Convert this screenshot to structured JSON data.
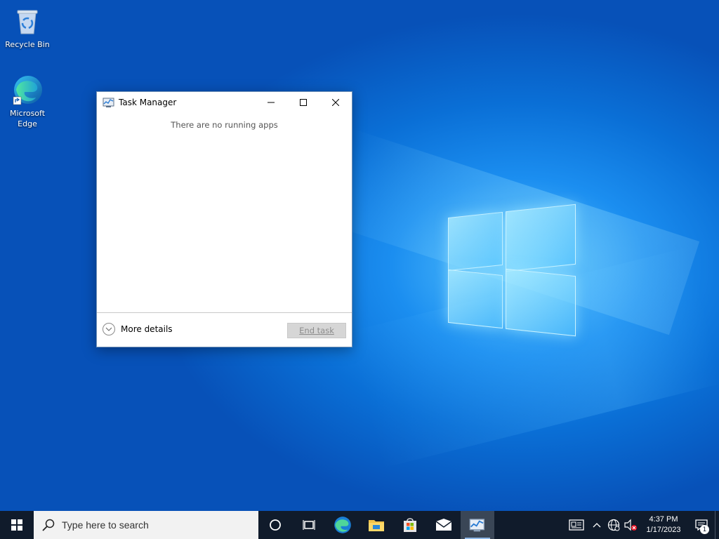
{
  "desktop": {
    "icons": [
      {
        "label": "Recycle Bin",
        "icon": "recycle-bin-icon"
      },
      {
        "label": "Microsoft\nEdge",
        "icon": "edge-icon"
      }
    ]
  },
  "task_manager": {
    "title": "Task Manager",
    "empty_message": "There are no running apps",
    "more_details_label": "More details",
    "end_task_label": "End task",
    "controls": [
      "minimize",
      "maximize",
      "close"
    ]
  },
  "taskbar": {
    "search_placeholder": "Type here to search",
    "pinned": [
      "cortana-icon",
      "task-view-icon",
      "edge-icon",
      "file-explorer-icon",
      "microsoft-store-icon",
      "mail-icon",
      "task-manager-icon"
    ],
    "active_app": "task-manager",
    "tray": {
      "icons": [
        "news-icon",
        "show-hidden-icons-chevron",
        "network-icon",
        "volume-muted-icon"
      ],
      "time": "4:37 PM",
      "date": "1/17/2023",
      "notification_count": "1"
    }
  },
  "colors": {
    "taskbar_bg": "#101b2b",
    "desktop_accent": "#0a6fd6",
    "active_underline": "#8fb8e8"
  }
}
